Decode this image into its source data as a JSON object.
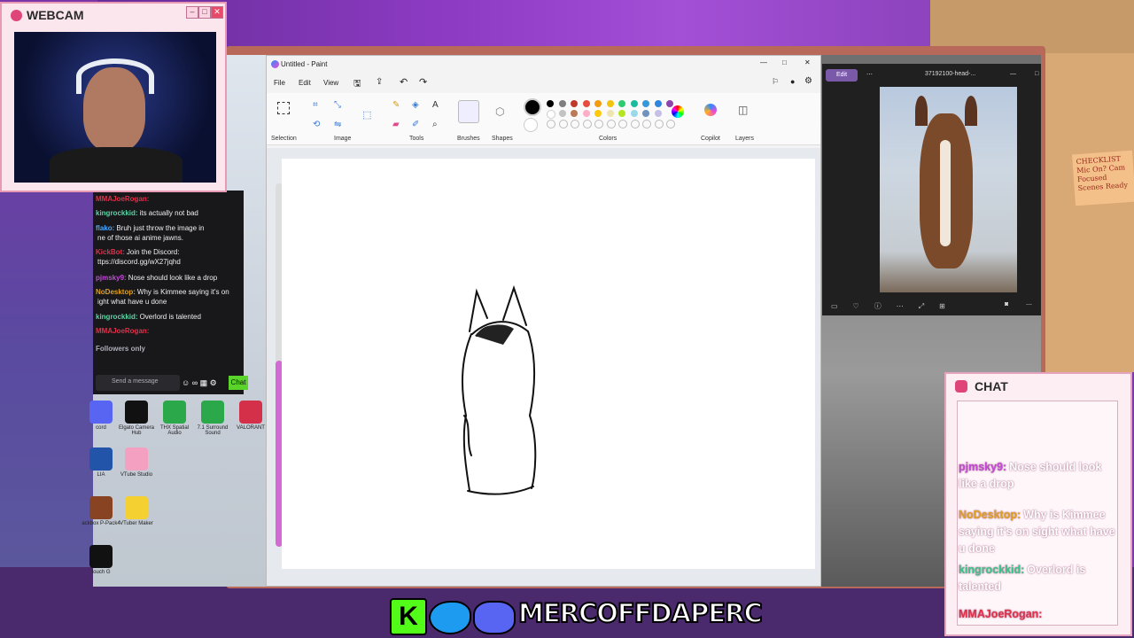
{
  "webcam": {
    "title": "WEBCAM",
    "icon": "camera-icon"
  },
  "twitch_chat": {
    "messages": [
      {
        "user": "MMAJoeRogan:",
        "text": "",
        "color": "#e0304a"
      },
      {
        "user": "kingrockkid:",
        "text": "its actually not bad",
        "color": "#5ad4a4"
      },
      {
        "user": "flako:",
        "text": "Bruh just throw the image in",
        "color": "#4aa8ff"
      },
      {
        "user": "",
        "text": "ne of those ai anime jawns.",
        "color": "#efeff1"
      },
      {
        "user": "KickBot:",
        "text": "Join the Discord:",
        "color": "#e0304a"
      },
      {
        "user": "",
        "text": "ttps://discord.gg/wX27jqhd",
        "color": "#efeff1"
      },
      {
        "user": "pjmsky9:",
        "text": "Nose should look like a drop",
        "color": "#c04ad4"
      },
      {
        "user": "NoDesktop:",
        "text": "Why is Kimmee saying it's on",
        "color": "#e0a020"
      },
      {
        "user": "",
        "text": "ight what have u done",
        "color": "#efeff1"
      },
      {
        "user": "kingrockkid:",
        "text": "Overlord is talented",
        "color": "#5ad4a4"
      },
      {
        "user": "MMAJoeRogan:",
        "text": "",
        "color": "#e0304a"
      },
      {
        "user": "Followers only",
        "text": "",
        "color": "#adadb8"
      }
    ],
    "input_placeholder": "Send a message",
    "chat_button": "Chat"
  },
  "desktop_icons": [
    {
      "label": "cord",
      "color": "#5865f2"
    },
    {
      "label": "Elgato Camera Hub",
      "color": "#111"
    },
    {
      "label": "THX Spatial Audio",
      "color": "#2aa84a"
    },
    {
      "label": "7.1 Surround Sound",
      "color": "#2aa84a"
    },
    {
      "label": "VALORANT",
      "color": "#d4304a"
    },
    {
      "label": "LIA",
      "color": "#2255aa"
    },
    {
      "label": "VTube Studio",
      "color": "#f4a0c0"
    },
    {
      "label": "ackbox P-Pack4",
      "color": "#884422"
    },
    {
      "label": "VTuber Maker",
      "color": "#f4d030"
    },
    {
      "label": "touch G",
      "color": "#111"
    }
  ],
  "paint": {
    "title": "Untitled - Paint",
    "menu": [
      "File",
      "Edit",
      "View"
    ],
    "groups": [
      "Selection",
      "Image",
      "Tools",
      "Brushes",
      "Shapes",
      "Colors",
      "Copilot",
      "Layers"
    ],
    "palette": [
      "#000000",
      "#7f7f7f",
      "#c0392b",
      "#e74c3c",
      "#f39c12",
      "#f1c40f",
      "#2ecc71",
      "#1abc9c",
      "#3498db",
      "#2e86de",
      "#8e44ad",
      "#ffffff",
      "#c3c3c3",
      "#b97a57",
      "#ffaec9",
      "#ffc90e",
      "#efe4b0",
      "#b5e61d",
      "#99d9ea",
      "#7092be",
      "#c8bfe7"
    ]
  },
  "photos": {
    "edit_label": "Edit",
    "filename": "37192100-head-..."
  },
  "sticky_note": {
    "text": "CHECKLIST Mic On? Cam Focused Scenes Ready"
  },
  "overlay_chat": {
    "title": "CHAT",
    "messages": [
      {
        "user": "pjmsky9:",
        "text": "Nose should look like a drop",
        "color": "#c04ad4"
      },
      {
        "user": "NoDesktop:",
        "text": "Why is Kimmee saying it's on sight what have u done",
        "color": "#e0a020"
      },
      {
        "user": "kingrockkid:",
        "text": "Overlord is talented",
        "color": "#3ac48a"
      },
      {
        "user": "MMAJoeRogan:",
        "text": "",
        "color": "#e0304a"
      }
    ]
  },
  "banner": {
    "text": "MERCOFFDAPERC",
    "icons": [
      "kick-icon",
      "twitter-icon",
      "discord-icon"
    ]
  }
}
